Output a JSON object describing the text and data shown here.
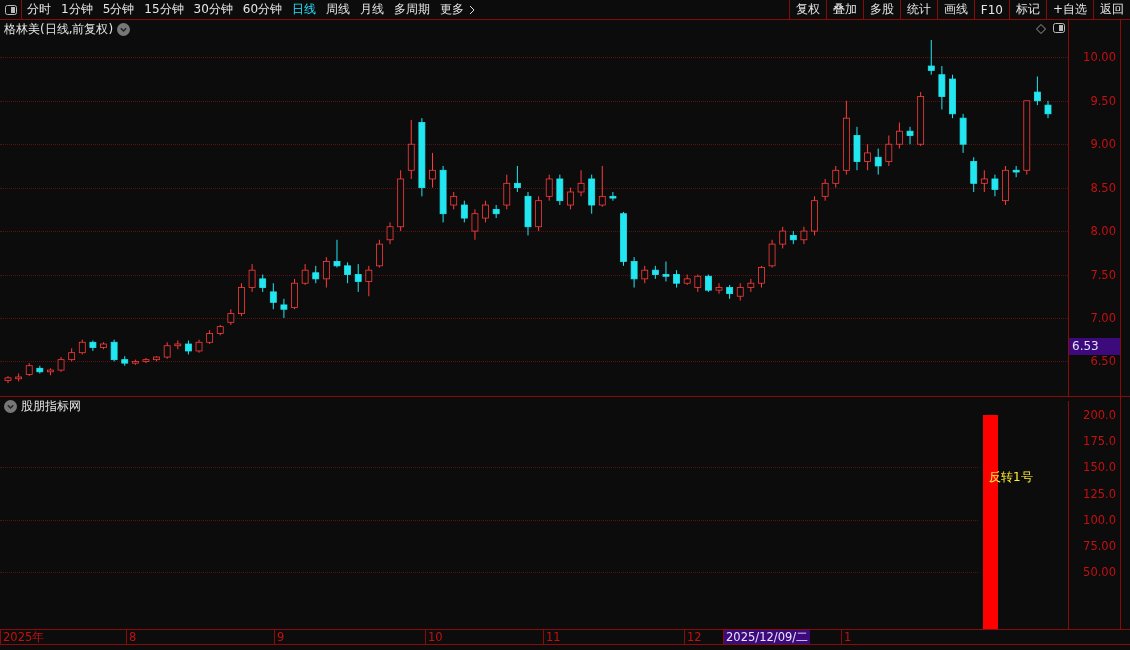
{
  "toolbar": {
    "periods": [
      {
        "label": "分时",
        "selected": false
      },
      {
        "label": "1分钟",
        "selected": false
      },
      {
        "label": "5分钟",
        "selected": false
      },
      {
        "label": "15分钟",
        "selected": false
      },
      {
        "label": "30分钟",
        "selected": false
      },
      {
        "label": "60分钟",
        "selected": false
      },
      {
        "label": "日线",
        "selected": true
      },
      {
        "label": "周线",
        "selected": false
      },
      {
        "label": "月线",
        "selected": false
      },
      {
        "label": "多周期",
        "selected": false
      },
      {
        "label": "更多",
        "selected": false
      }
    ],
    "actions": [
      "复权",
      "叠加",
      "多股",
      "统计",
      "画线",
      "F10",
      "标记",
      "+自选",
      "返回"
    ]
  },
  "price_chart": {
    "title": "格林美(日线,前复权)",
    "current_price": "6.53",
    "chart_data": {
      "type": "candlestick",
      "ylim": [
        6.09,
        10.43
      ],
      "grid": true,
      "yticks": [
        {
          "value": 10,
          "label": "10.00"
        },
        {
          "value": 9.5,
          "label": "9.50"
        },
        {
          "value": 9,
          "label": "9.00"
        },
        {
          "value": 8.5,
          "label": "8.50"
        },
        {
          "value": 8,
          "label": "8.00"
        },
        {
          "value": 7.5,
          "label": "7.50"
        },
        {
          "value": 7,
          "label": "7.00"
        },
        {
          "value": 6.5,
          "label": "6.50"
        }
      ],
      "ohlc": [
        [
          6.28,
          6.33,
          6.25,
          6.31
        ],
        [
          6.3,
          6.36,
          6.27,
          6.32
        ],
        [
          6.35,
          6.48,
          6.33,
          6.45
        ],
        [
          6.42,
          6.45,
          6.36,
          6.38
        ],
        [
          6.38,
          6.42,
          6.34,
          6.4
        ],
        [
          6.4,
          6.55,
          6.38,
          6.52
        ],
        [
          6.52,
          6.65,
          6.5,
          6.6
        ],
        [
          6.6,
          6.75,
          6.58,
          6.72
        ],
        [
          6.72,
          6.74,
          6.62,
          6.66
        ],
        [
          6.66,
          6.72,
          6.64,
          6.7
        ],
        [
          6.72,
          6.75,
          6.5,
          6.52
        ],
        [
          6.52,
          6.56,
          6.45,
          6.48
        ],
        [
          6.48,
          6.52,
          6.46,
          6.5
        ],
        [
          6.5,
          6.54,
          6.48,
          6.52
        ],
        [
          6.52,
          6.56,
          6.5,
          6.55
        ],
        [
          6.55,
          6.72,
          6.53,
          6.68
        ],
        [
          6.68,
          6.74,
          6.64,
          6.7
        ],
        [
          6.7,
          6.74,
          6.58,
          6.62
        ],
        [
          6.62,
          6.75,
          6.6,
          6.72
        ],
        [
          6.72,
          6.86,
          6.7,
          6.82
        ],
        [
          6.82,
          6.92,
          6.8,
          6.9
        ],
        [
          6.95,
          7.1,
          6.92,
          7.05
        ],
        [
          7.05,
          7.4,
          7.02,
          7.35
        ],
        [
          7.35,
          7.62,
          7.3,
          7.55
        ],
        [
          7.45,
          7.5,
          7.3,
          7.35
        ],
        [
          7.3,
          7.4,
          7.1,
          7.18
        ],
        [
          7.15,
          7.22,
          7.0,
          7.1
        ],
        [
          7.12,
          7.45,
          7.1,
          7.4
        ],
        [
          7.4,
          7.62,
          7.38,
          7.55
        ],
        [
          7.52,
          7.6,
          7.4,
          7.45
        ],
        [
          7.45,
          7.7,
          7.35,
          7.65
        ],
        [
          7.65,
          7.9,
          7.58,
          7.6
        ],
        [
          7.6,
          7.64,
          7.4,
          7.5
        ],
        [
          7.5,
          7.62,
          7.3,
          7.42
        ],
        [
          7.42,
          7.6,
          7.25,
          7.55
        ],
        [
          7.6,
          7.9,
          7.58,
          7.85
        ],
        [
          7.9,
          8.1,
          7.85,
          8.05
        ],
        [
          8.05,
          8.7,
          8.0,
          8.6
        ],
        [
          8.7,
          9.28,
          8.6,
          9.0
        ],
        [
          9.25,
          9.3,
          8.4,
          8.5
        ],
        [
          8.6,
          8.9,
          8.5,
          8.7
        ],
        [
          8.7,
          8.75,
          8.1,
          8.2
        ],
        [
          8.3,
          8.45,
          8.25,
          8.4
        ],
        [
          8.3,
          8.35,
          8.1,
          8.15
        ],
        [
          8.0,
          8.25,
          7.9,
          8.2
        ],
        [
          8.15,
          8.35,
          8.1,
          8.3
        ],
        [
          8.25,
          8.3,
          8.15,
          8.2
        ],
        [
          8.3,
          8.65,
          8.25,
          8.55
        ],
        [
          8.55,
          8.75,
          8.45,
          8.5
        ],
        [
          8.4,
          8.45,
          7.95,
          8.05
        ],
        [
          8.05,
          8.4,
          8.0,
          8.35
        ],
        [
          8.4,
          8.65,
          8.35,
          8.6
        ],
        [
          8.6,
          8.65,
          8.3,
          8.35
        ],
        [
          8.3,
          8.5,
          8.25,
          8.45
        ],
        [
          8.45,
          8.7,
          8.4,
          8.55
        ],
        [
          8.6,
          8.65,
          8.2,
          8.3
        ],
        [
          8.3,
          8.75,
          8.28,
          8.4
        ],
        [
          8.4,
          8.45,
          8.35,
          8.38
        ],
        [
          8.2,
          8.22,
          7.6,
          7.65
        ],
        [
          7.65,
          7.7,
          7.35,
          7.45
        ],
        [
          7.45,
          7.6,
          7.4,
          7.55
        ],
        [
          7.55,
          7.6,
          7.45,
          7.5
        ],
        [
          7.5,
          7.65,
          7.42,
          7.48
        ],
        [
          7.5,
          7.55,
          7.35,
          7.4
        ],
        [
          7.4,
          7.5,
          7.38,
          7.45
        ],
        [
          7.35,
          7.5,
          7.3,
          7.48
        ],
        [
          7.48,
          7.5,
          7.3,
          7.32
        ],
        [
          7.32,
          7.4,
          7.28,
          7.35
        ],
        [
          7.35,
          7.38,
          7.22,
          7.28
        ],
        [
          7.25,
          7.4,
          7.2,
          7.35
        ],
        [
          7.35,
          7.45,
          7.3,
          7.4
        ],
        [
          7.4,
          7.6,
          7.35,
          7.58
        ],
        [
          7.6,
          7.9,
          7.58,
          7.85
        ],
        [
          7.85,
          8.05,
          7.8,
          8.0
        ],
        [
          7.95,
          8.0,
          7.85,
          7.9
        ],
        [
          7.9,
          8.05,
          7.85,
          8.0
        ],
        [
          8.0,
          8.4,
          7.95,
          8.35
        ],
        [
          8.4,
          8.6,
          8.35,
          8.55
        ],
        [
          8.55,
          8.75,
          8.5,
          8.7
        ],
        [
          8.7,
          9.5,
          8.65,
          9.3
        ],
        [
          9.1,
          9.2,
          8.7,
          8.8
        ],
        [
          8.8,
          9.0,
          8.7,
          8.9
        ],
        [
          8.85,
          8.95,
          8.65,
          8.75
        ],
        [
          8.8,
          9.1,
          8.75,
          9.0
        ],
        [
          9.0,
          9.25,
          8.95,
          9.15
        ],
        [
          9.15,
          9.2,
          9.0,
          9.1
        ],
        [
          9.0,
          9.6,
          8.98,
          9.55
        ],
        [
          9.9,
          10.2,
          9.8,
          9.85
        ],
        [
          9.8,
          9.9,
          9.4,
          9.55
        ],
        [
          9.75,
          9.8,
          9.3,
          9.35
        ],
        [
          9.3,
          9.35,
          8.9,
          9.0
        ],
        [
          8.8,
          8.85,
          8.45,
          8.55
        ],
        [
          8.55,
          8.7,
          8.45,
          8.6
        ],
        [
          8.6,
          8.65,
          8.4,
          8.48
        ],
        [
          8.35,
          8.75,
          8.3,
          8.7
        ],
        [
          8.7,
          8.75,
          8.62,
          8.68
        ],
        [
          8.7,
          9.5,
          8.65,
          9.5
        ],
        [
          9.6,
          9.78,
          9.45,
          9.5
        ],
        [
          9.45,
          9.5,
          9.3,
          9.35
        ]
      ]
    }
  },
  "indicator": {
    "title": "股朋指标网",
    "y_ticks": [
      "200.0",
      "175.0",
      "150.0",
      "125.0",
      "100.0",
      "75.00",
      "50.00"
    ],
    "signal_label": "反转1号"
  },
  "date_axis": [
    {
      "label": "2025年",
      "selected": false
    },
    {
      "label": "8",
      "selected": false
    },
    {
      "label": "9",
      "selected": false
    },
    {
      "label": "10",
      "selected": false
    },
    {
      "label": "11",
      "selected": false
    },
    {
      "label": "12",
      "selected": false
    },
    {
      "label": "2025/12/09/二",
      "selected": true
    },
    {
      "label": "1",
      "selected": false
    }
  ]
}
